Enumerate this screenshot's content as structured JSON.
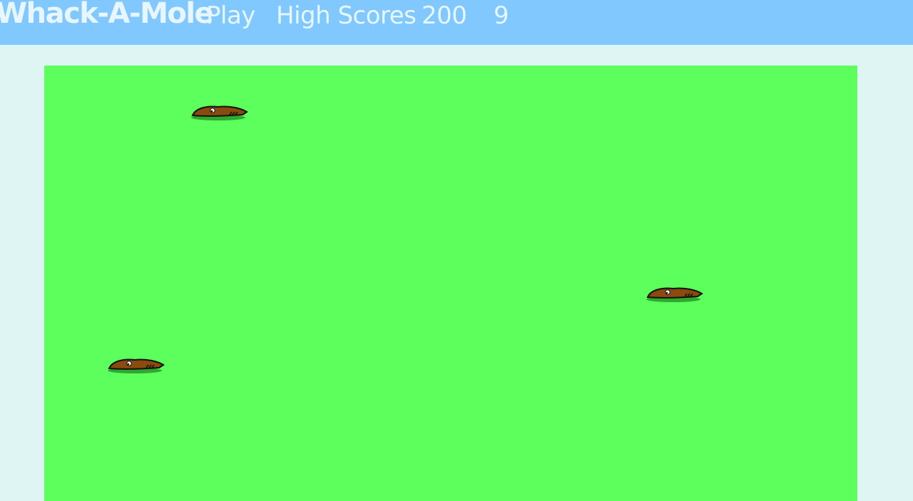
{
  "colors": {
    "page_background": "#dff5f4",
    "navbar_background": "#80c8ff",
    "navbar_text": "#e8f6ff",
    "playfield_background": "#5cff5c",
    "mole_body": "#8b4a0e",
    "mole_outline": "#111111",
    "hole_grass": "#2fa82f"
  },
  "navbar": {
    "brand": "Whack-A-Mole",
    "play_label": "Play",
    "high_scores_label": "High Scores",
    "score": "200",
    "time_left": "9"
  },
  "game": {
    "moles_visible": 3,
    "mole_state": "peeking",
    "mole_icon": "mole-in-hole-icon"
  }
}
